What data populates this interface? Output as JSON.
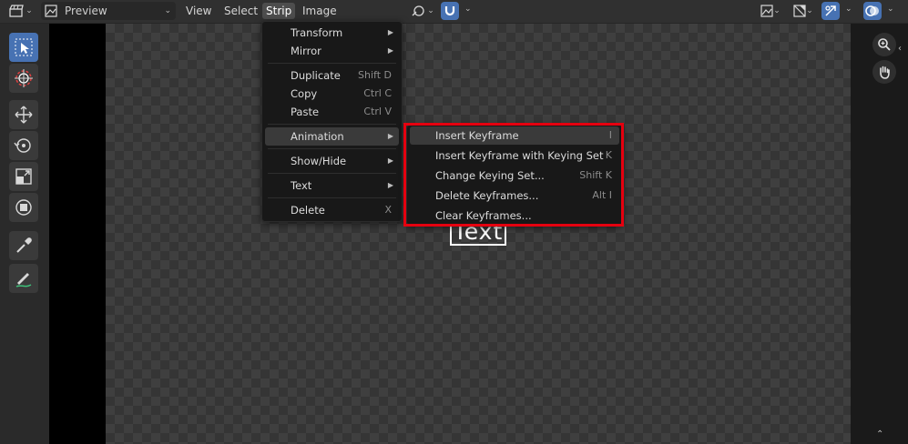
{
  "header": {
    "editor_type_icon": "clapperboard-icon",
    "view_mode_icon": "preview-icon",
    "view_mode_value": "Preview",
    "menus": [
      "View",
      "Select",
      "Strip",
      "Image"
    ],
    "active_menu": "Strip",
    "right_icons": [
      "link-icon",
      "magnet-icon",
      "display-channel-icon",
      "image-icon",
      "gizmo-icon",
      "overlay-icon"
    ]
  },
  "toolbar": {
    "tools": [
      "select-box-icon",
      "cursor-icon",
      "move-icon",
      "rotate-icon",
      "scale-icon",
      "transform-icon",
      "sample-icon",
      "annotate-icon"
    ],
    "active_tool": "select-box-icon"
  },
  "viewport": {
    "text_object": "Text",
    "nav_icons": [
      "zoom-icon",
      "hand-icon"
    ]
  },
  "strip_menu": {
    "items": [
      {
        "label": "Transform",
        "submenu": true
      },
      {
        "label": "Mirror",
        "submenu": true
      },
      {
        "label": "Duplicate",
        "shortcut": "Shift D"
      },
      {
        "label": "Copy",
        "shortcut": "Ctrl C"
      },
      {
        "label": "Paste",
        "shortcut": "Ctrl V"
      },
      {
        "label": "Animation",
        "submenu": true,
        "highlighted": true
      },
      {
        "label": "Show/Hide",
        "submenu": true
      },
      {
        "label": "Text",
        "submenu": true
      },
      {
        "label": "Delete",
        "shortcut": "X"
      }
    ]
  },
  "animation_submenu": {
    "items": [
      {
        "label": "Insert Keyframe",
        "shortcut": "I",
        "highlighted": true
      },
      {
        "label": "Insert Keyframe with Keying Set",
        "shortcut": "K"
      },
      {
        "label": "Change Keying Set...",
        "shortcut": "Shift K"
      },
      {
        "label": "Delete Keyframes...",
        "shortcut": "Alt I"
      },
      {
        "label": "Clear Keyframes...",
        "shortcut": ""
      }
    ],
    "highlight_color": "#e5000f"
  },
  "colors": {
    "accent": "#4772b3",
    "annotation_red": "#e5000f"
  }
}
